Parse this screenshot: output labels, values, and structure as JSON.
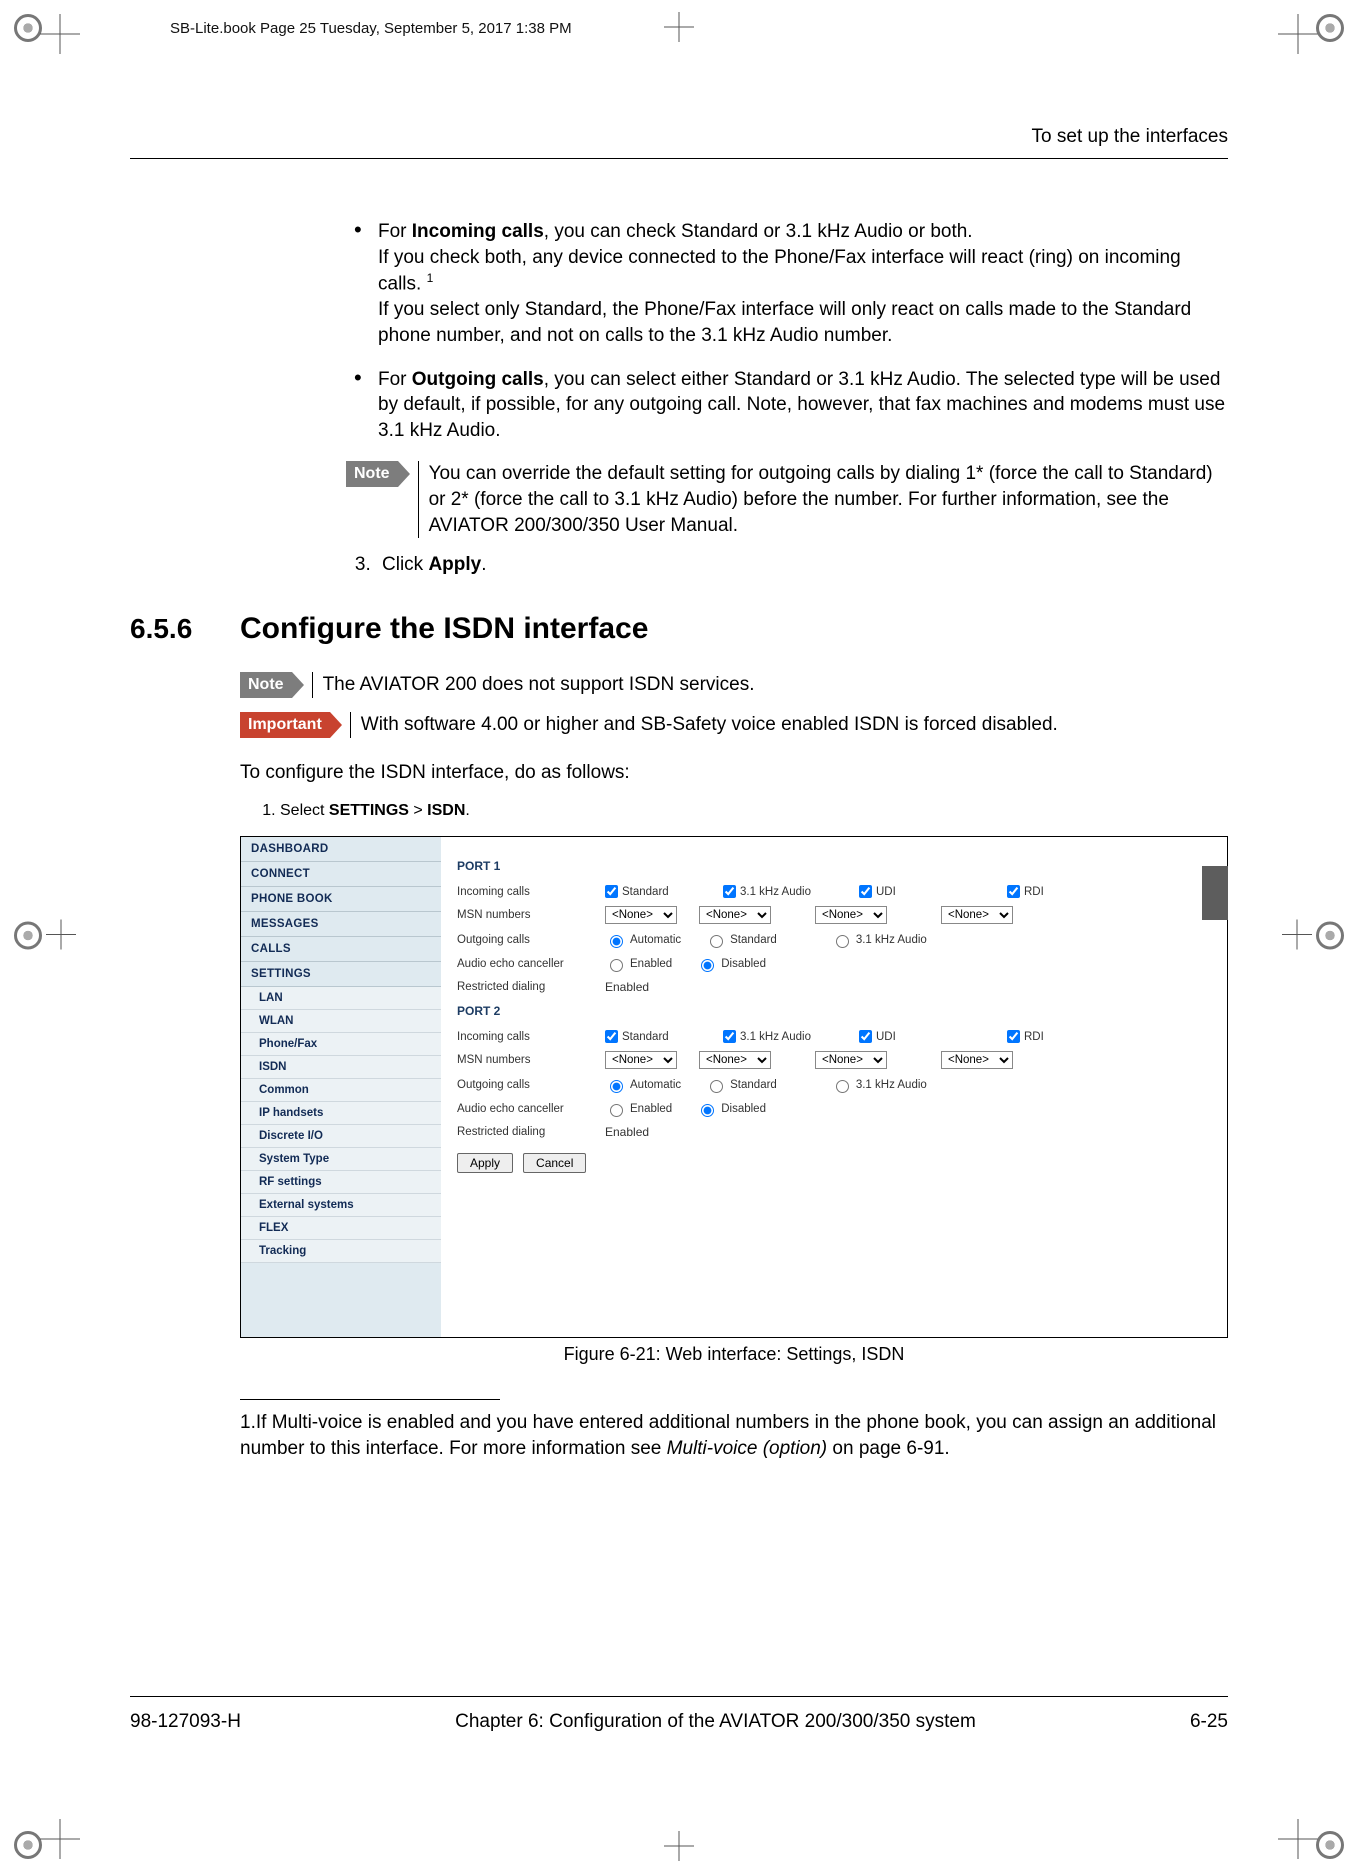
{
  "print_tag": "SB-Lite.book  Page 25  Tuesday, September 5, 2017  1:38 PM",
  "running_head": "To set up the interfaces",
  "bullets": {
    "b1_prefix": "For ",
    "b1_bold": "Incoming calls",
    "b1_suffix": ", you can check Standard or 3.1 kHz Audio or both.",
    "b1_line2": "If you check both, any device connected to the Phone/Fax interface will react (ring) on incoming calls. ",
    "b1_footref": "1",
    "b1_line3": "If you select only Standard, the Phone/Fax interface will only react on calls made to the Standard phone number, and not on calls to the 3.1 kHz Audio number.",
    "b2_prefix": "For ",
    "b2_bold": "Outgoing calls",
    "b2_suffix": ", you can select either Standard or 3.1 kHz Audio. The selected type will be used by default, if possible, for any outgoing call. Note, however, that fax machines and modems must use 3.1 kHz Audio."
  },
  "note_tag": "Note",
  "important_tag": "Important",
  "note1": "You can override the default setting for outgoing calls by dialing 1* (force the call to Standard) or 2* (force the call to 3.1 kHz Audio) before the number. For further information, see the AVIATOR 200/300/350 User Manual.",
  "step3_prefix": "Click ",
  "step3_bold": "Apply",
  "step3_suffix": ".",
  "section_num": "6.5.6",
  "section_title": "Configure the ISDN interface",
  "note2": "The AVIATOR 200 does not support ISDN services.",
  "important1": "With software 4.00 or higher and SB-Safety voice enabled ISDN is forced disabled.",
  "intro": "To configure the ISDN interface, do as follows:",
  "step1_prefix": "Select ",
  "step1_b1": "SETTINGS",
  "step1_sep": " > ",
  "step1_b2": "ISDN",
  "step1_suffix": ".",
  "figure_caption": "Figure 6-21: Web interface: Settings, ISDN",
  "sidebar": {
    "dashboard": "DASHBOARD",
    "connect": "CONNECT",
    "phonebook": "PHONE BOOK",
    "messages": "MESSAGES",
    "calls": "CALLS",
    "settings": "SETTINGS",
    "lan": "LAN",
    "wlan": "WLAN",
    "phonefax": "Phone/Fax",
    "isdn": "ISDN",
    "common": "Common",
    "iphandsets": "IP handsets",
    "discreteio": "Discrete I/O",
    "systemtype": "System Type",
    "rfsettings": "RF settings",
    "extsys": "External systems",
    "flex": "FLEX",
    "tracking": "Tracking"
  },
  "form": {
    "port1": "PORT 1",
    "port2": "PORT 2",
    "incoming": "Incoming calls",
    "msn": "MSN numbers",
    "outgoing": "Outgoing calls",
    "echo": "Audio echo canceller",
    "restricted": "Restricted dialing",
    "standard": "Standard",
    "khz": "3.1 kHz Audio",
    "udi": "UDI",
    "rdi": "RDI",
    "none": "<None>",
    "automatic": "Automatic",
    "enabled": "Enabled",
    "disabled": "Disabled",
    "apply": "Apply",
    "cancel": "Cancel"
  },
  "footnote_num": "1.",
  "footnote_text_a": "If Multi-voice is enabled and you have entered additional numbers in the phone book, you can assign an additional number to this interface. For more information see ",
  "footnote_text_it": "Multi-voice (option)",
  "footnote_text_b": " on page 6-91.",
  "footer": {
    "docnum": "98-127093-H",
    "chapter": "Chapter 6:  Configuration of the AVIATOR 200/300/350 system",
    "pagenum": "6-25"
  }
}
